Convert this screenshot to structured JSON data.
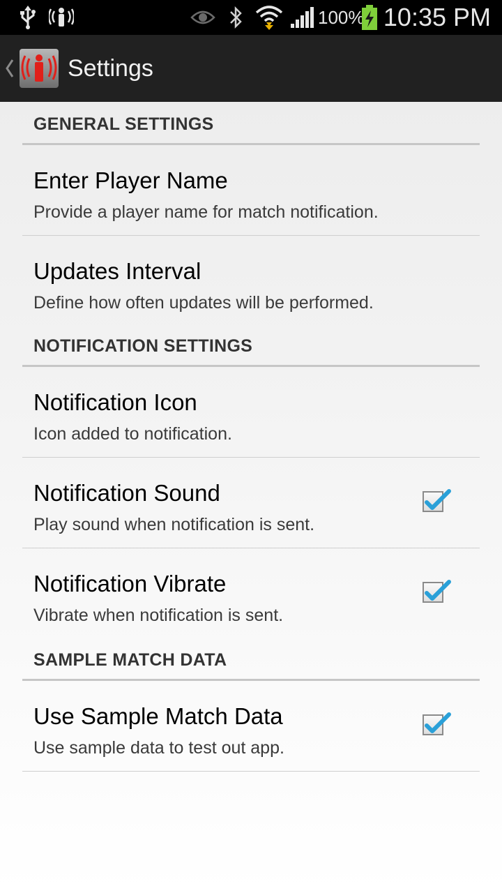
{
  "status_bar": {
    "icons_left": [
      "usb-icon",
      "signal-broadcast-icon"
    ],
    "icons_right": [
      "eye-icon",
      "bluetooth-icon",
      "wifi-icon",
      "cellular-signal-icon",
      "battery-charging-icon"
    ],
    "battery_percent": "100%",
    "time": "10:35 PM"
  },
  "action_bar": {
    "title": "Settings"
  },
  "sections": {
    "general": {
      "header": "GENERAL SETTINGS",
      "items": [
        {
          "title": "Enter Player Name",
          "summary": "Provide a player name for match notification."
        },
        {
          "title": "Updates Interval",
          "summary": "Define how often updates will be performed."
        }
      ]
    },
    "notification": {
      "header": "NOTIFICATION SETTINGS",
      "items": [
        {
          "title": "Notification Icon",
          "summary": "Icon added to notification."
        },
        {
          "title": "Notification Sound",
          "summary": "Play sound when notification is sent.",
          "checked": true
        },
        {
          "title": "Notification Vibrate",
          "summary": "Vibrate when notification is sent.",
          "checked": true
        }
      ]
    },
    "sample": {
      "header": "SAMPLE MATCH DATA",
      "items": [
        {
          "title": "Use Sample Match Data",
          "summary": "Use sample data to test out app.",
          "checked": true
        }
      ]
    }
  },
  "colors": {
    "status_bar_bg": "#000000",
    "action_bar_bg": "#212121",
    "checkmark": "#2aa0d8",
    "app_icon_red": "#e0201a"
  }
}
